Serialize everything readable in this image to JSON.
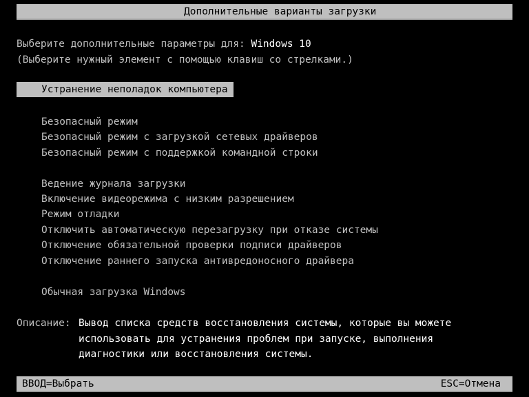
{
  "header": {
    "title": "Дополнительные варианты загрузки"
  },
  "prompt": {
    "line1_prefix": "Выберите дополнительные параметры для: ",
    "os_name": "Windows 10",
    "line2": "(Выберите нужный элемент с помощью клавиш со стрелками.)"
  },
  "menu": {
    "selected_index": 0,
    "items": [
      {
        "label": "Устранение неполадок компьютера"
      },
      {
        "label": "Безопасный режим"
      },
      {
        "label": "Безопасный режим с загрузкой сетевых драйверов"
      },
      {
        "label": "Безопасный режим с поддержкой командной строки"
      },
      {
        "label": "Ведение журнала загрузки"
      },
      {
        "label": "Включение видеорежима с низким разрешением"
      },
      {
        "label": "Режим отладки"
      },
      {
        "label": "Отключить автоматическую перезагрузку при отказе системы"
      },
      {
        "label": "Отключение обязательной проверки подписи драйверов"
      },
      {
        "label": "Отключение раннего запуска антивредоносного драйвера"
      },
      {
        "label": "Обычная загрузка Windows"
      }
    ]
  },
  "description": {
    "label": "Описание:",
    "lines": [
      "Вывод списка средств восстановления системы, которые вы можете",
      "использовать для устранения проблем при запуске, выполнения",
      "диагностики или восстановления системы."
    ]
  },
  "footer": {
    "enter_hint": "ВВОД=Выбрать",
    "esc_hint": "ESC=Отмена"
  },
  "colors": {
    "background": "#000000",
    "text": "#c0c0c0",
    "highlight_text": "#ffffff",
    "bar_background": "#bfbfbf",
    "bar_text": "#000000"
  }
}
